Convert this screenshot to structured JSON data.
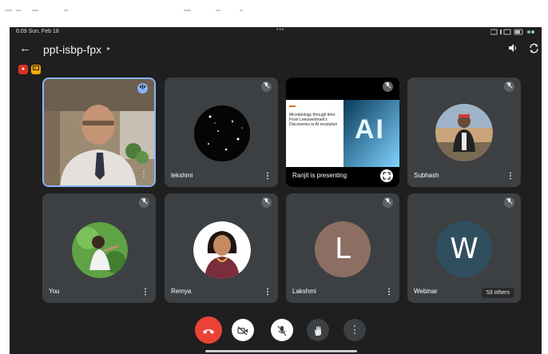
{
  "status_bar": {
    "time": "6:09 Sun, Feb 18",
    "dots": "•••"
  },
  "header": {
    "meeting_code": "ppt-isbp-fpx",
    "chevron": "▸"
  },
  "participants": [
    {
      "name": "",
      "type": "video"
    },
    {
      "name": "lekshmi",
      "type": "avatar"
    },
    {
      "name": "Ranjit is presenting",
      "type": "presentation",
      "slide_title": "Microbiology through time: From Leeuwenhoek's Discoveries to AI revolution",
      "slide_big_text": "AI"
    },
    {
      "name": "Subhash",
      "type": "avatar"
    },
    {
      "name": "You",
      "type": "avatar"
    },
    {
      "name": "Remya",
      "type": "avatar"
    },
    {
      "name": "Lakshmi",
      "type": "letter",
      "letter": "L",
      "color": "#8d6e63"
    },
    {
      "name": "Webinar",
      "type": "letter",
      "letter": "W",
      "color": "#2f4f5f",
      "badge": "53 others"
    }
  ],
  "colors": {
    "background": "#1f1f1f",
    "tile": "#3c4043",
    "end_call": "#ea4335"
  }
}
